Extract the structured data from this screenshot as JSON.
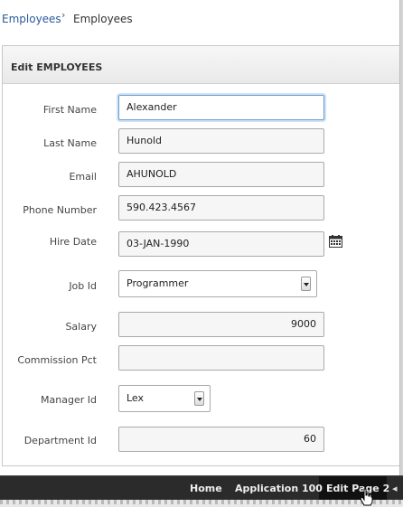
{
  "breadcrumb": {
    "parent": "Employees",
    "current": "Employees"
  },
  "region": {
    "title": "Edit EMPLOYEES"
  },
  "form": {
    "first_name": {
      "label": "First Name",
      "value": "Alexander"
    },
    "last_name": {
      "label": "Last Name",
      "value": "Hunold"
    },
    "email": {
      "label": "Email",
      "value": "AHUNOLD"
    },
    "phone": {
      "label": "Phone Number",
      "value": "590.423.4567"
    },
    "hire_date": {
      "label": "Hire Date",
      "value": "03-JAN-1990"
    },
    "job_id": {
      "label": "Job Id",
      "value": "Programmer"
    },
    "salary": {
      "label": "Salary",
      "value": "9000"
    },
    "commission": {
      "label": "Commission Pct",
      "value": ""
    },
    "manager": {
      "label": "Manager Id",
      "value": "Lex"
    },
    "department": {
      "label": "Department Id",
      "value": "60"
    }
  },
  "devbar": {
    "home": "Home",
    "application": "Application 100",
    "edit_page": "Edit Page 2"
  },
  "icons": {
    "calendar": "calendar-icon",
    "breadcrumb_separator": "chevron-right-icon",
    "select_arrow": "chevron-down-icon",
    "cursor": "hand-cursor-icon"
  },
  "colors": {
    "link": "#2a5b9c",
    "focus_border": "#6b9dd0",
    "devbar_bg": "#2b2b2b"
  }
}
